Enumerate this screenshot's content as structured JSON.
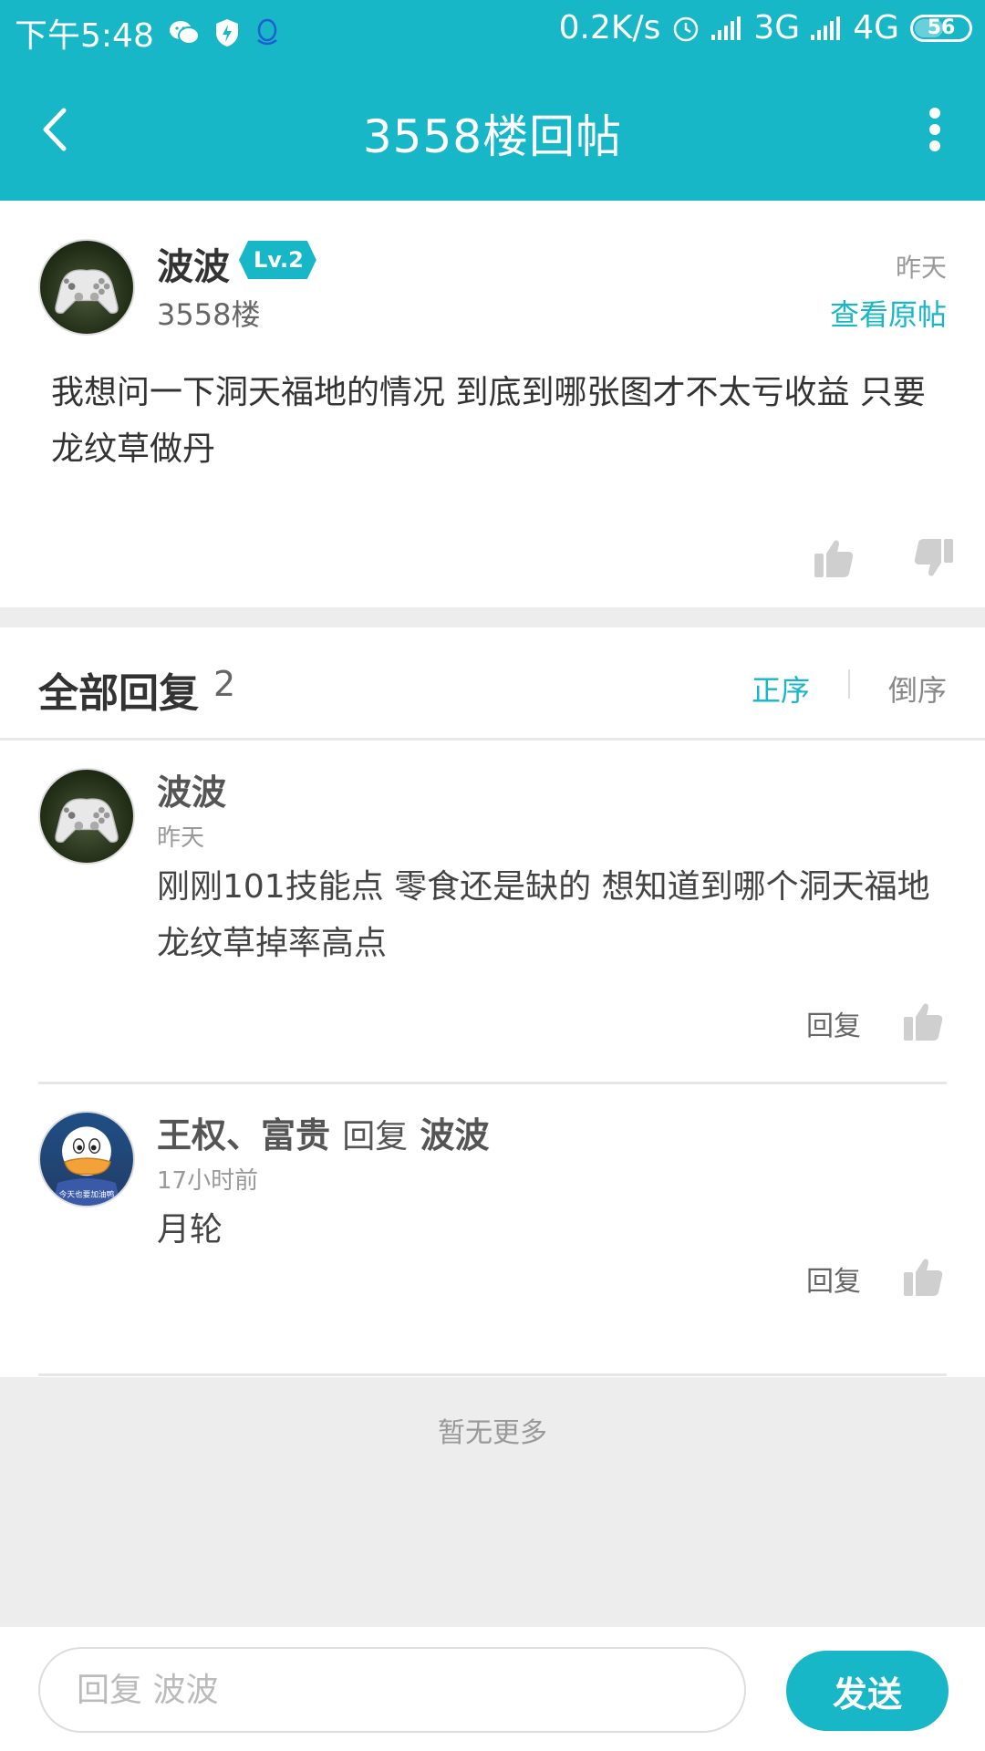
{
  "status_bar": {
    "time": "下午5:48",
    "net_speed": "0.2K/s",
    "net1": "3G",
    "net2": "4G",
    "battery": "56",
    "icons": [
      "wechat-icon",
      "shield-icon",
      "qq-icon",
      "alarm-icon",
      "signal-icon",
      "battery-icon"
    ]
  },
  "nav": {
    "title": "3558楼回帖",
    "back_icon": "back-arrow-icon",
    "more_icon": "more-vertical-icon"
  },
  "post": {
    "author": "波波",
    "level": "Lv.2",
    "floor": "3558楼",
    "time": "昨天",
    "view_original": "查看原帖",
    "body": "我想问一下洞天福地的情况 到底到哪张图才不太亏收益 只要龙纹草做丹"
  },
  "replies": {
    "title": "全部回复",
    "count": "2",
    "sort_asc": "正序",
    "sort_desc": "倒序",
    "items": [
      {
        "author": "波波",
        "time": "昨天",
        "body": "刚刚101技能点 零食还是缺的 想知道到哪个洞天福地龙纹草掉率高点",
        "reply_label": "回复"
      },
      {
        "author": "王权、富贵",
        "reply_word": "回复",
        "reply_to": "波波",
        "time": "17小时前",
        "body": "月轮",
        "reply_label": "回复",
        "avatar_caption": "今天也要加油鸭"
      }
    ]
  },
  "no_more": "暂无更多",
  "bottom": {
    "input_placeholder": "回复 波波",
    "send_label": "发送"
  },
  "colors": {
    "accent": "#17b7c7",
    "background": "#ededed",
    "card": "#ffffff"
  }
}
